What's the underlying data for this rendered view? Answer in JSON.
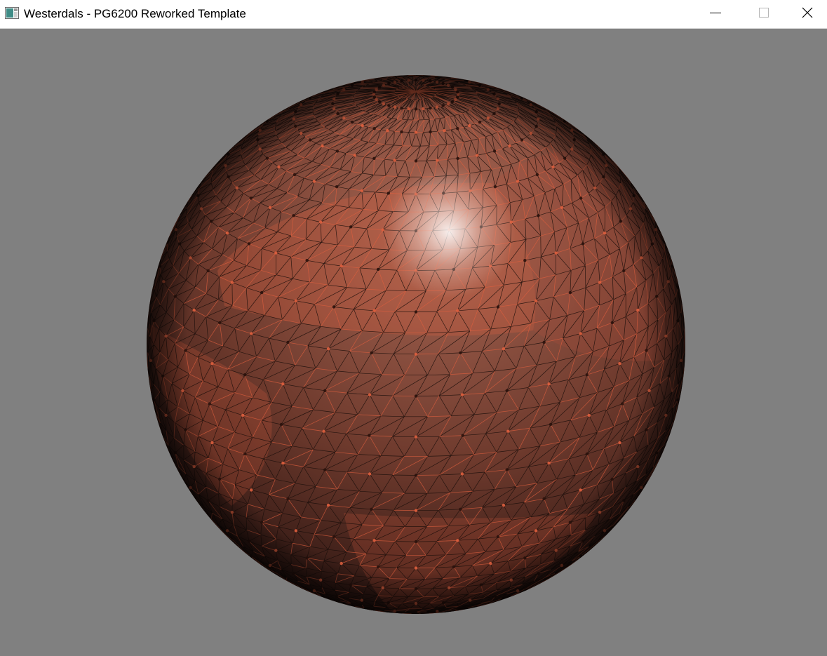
{
  "window": {
    "title": "Westerdals - PG6200 Reworked Template",
    "icon": "app-window-icon",
    "controls": {
      "minimize": "minimize-icon",
      "maximize": "maximize-icon",
      "close": "close-icon"
    }
  },
  "viewport": {
    "clear_color": "#808080",
    "scene": {
      "object": "wireframe-sphere",
      "wire_color": "#1a0e0a",
      "surface_color": "#8a3a28",
      "accent_color": "#e0603f",
      "highlight_color": "#ffffff"
    }
  }
}
